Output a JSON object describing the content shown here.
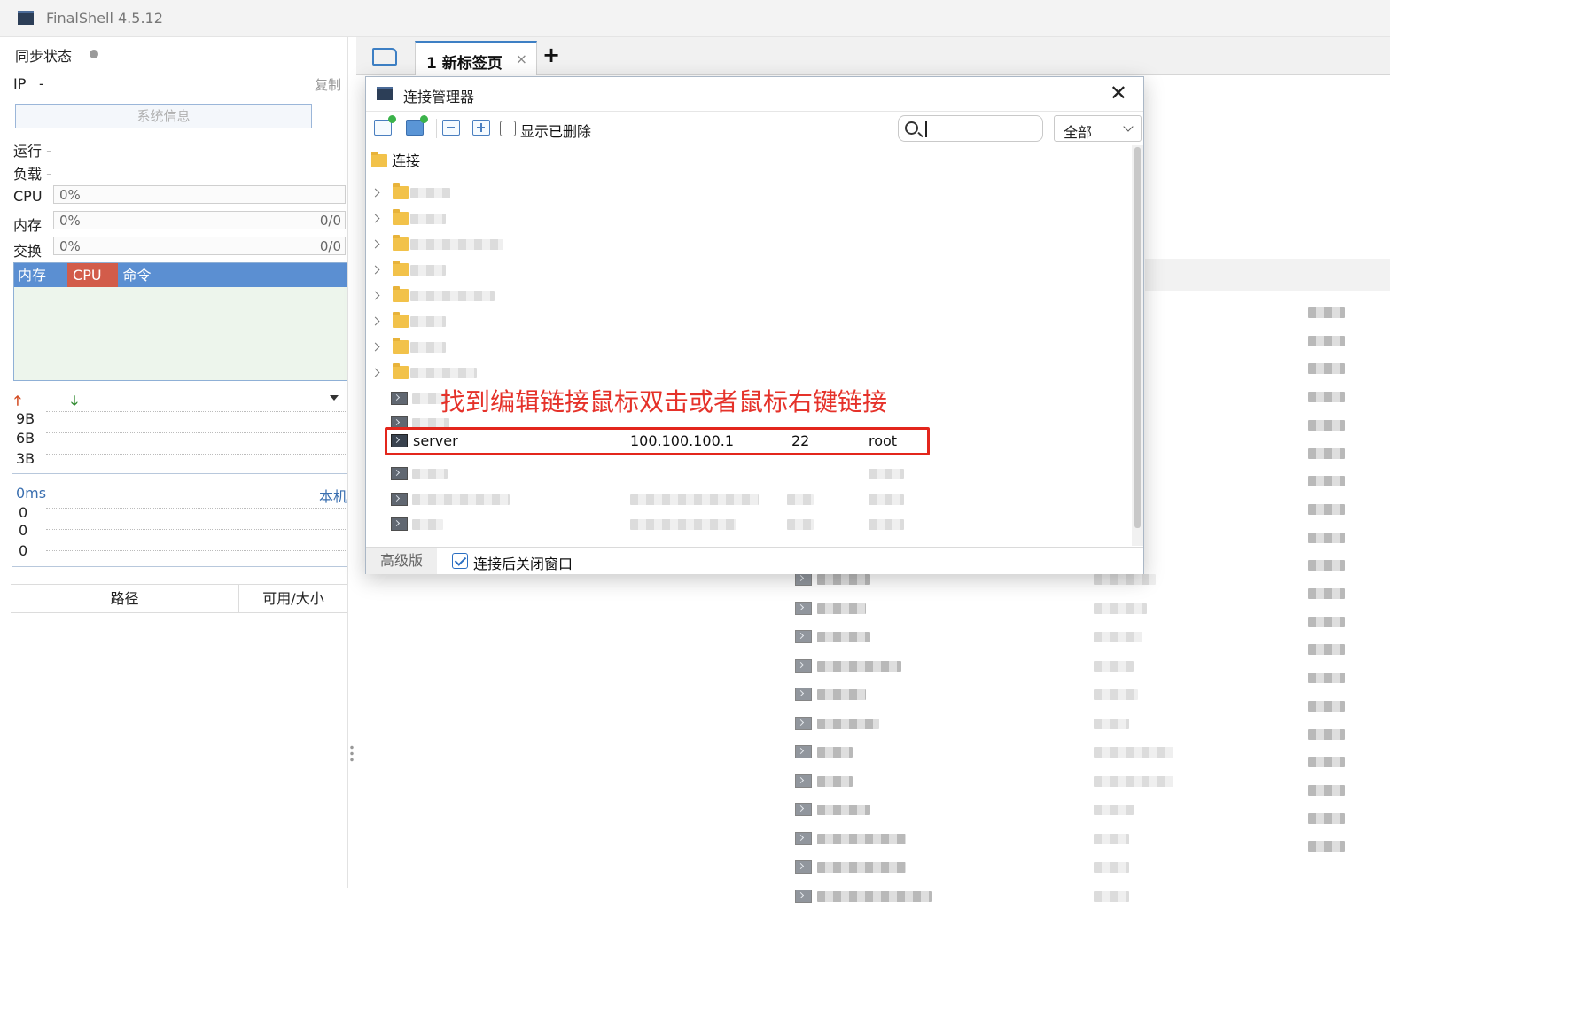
{
  "app": {
    "title": "FinalShell 4.5.12"
  },
  "left": {
    "sync_label": "同步状态",
    "ip_label": "IP",
    "ip_value": "-",
    "copy_label": "复制",
    "sysinfo_button": "系统信息",
    "run_label": "运行 -",
    "load_label": "负载 -",
    "cpu_label": "CPU",
    "cpu_value": "0%",
    "mem_label": "内存",
    "mem_value": "0%",
    "mem_total": "0/0",
    "swap_label": "交换",
    "swap_value": "0%",
    "swap_total": "0/0",
    "proc_tabs": {
      "mem": "内存",
      "cpu": "CPU",
      "cmd": "命令"
    },
    "net_ticks": [
      "9B",
      "6B",
      "3B"
    ],
    "latency_label": "0ms",
    "latency_host": "本机",
    "latency_ticks": [
      "0",
      "0",
      "0"
    ],
    "disk_headers": {
      "path": "路径",
      "size": "可用/大小"
    }
  },
  "tabs": {
    "active_label": "1 新标签页",
    "close": "×",
    "add": "+"
  },
  "dialog": {
    "title": "连接管理器",
    "close": "✕",
    "show_deleted_label": "显示已删除",
    "show_deleted_checked": false,
    "filter_value": "全部",
    "root_label": "连接",
    "highlight_row": {
      "name": "server",
      "host": "100.100.100.1",
      "port": "22",
      "user": "root"
    },
    "annotation": "找到编辑链接鼠标双击或者鼠标右键链接",
    "advanced_label": "高级版",
    "close_after_connect_label": "连接后关闭窗口",
    "close_after_connect_checked": true
  },
  "icons": [
    "app-icon",
    "folder-open-icon",
    "add-connection-icon",
    "add-folder-icon",
    "collapse-icon",
    "expand-icon",
    "search-icon",
    "chevron-down-icon",
    "folder-icon",
    "terminal-icon",
    "close-icon",
    "upload-arrow-icon",
    "download-arrow-icon"
  ],
  "colors": {
    "accent": "#3d7fc4",
    "annotation_red": "#e3261c",
    "proc_header": "#5b8fd2",
    "cpu_tab": "#d25c4a"
  }
}
